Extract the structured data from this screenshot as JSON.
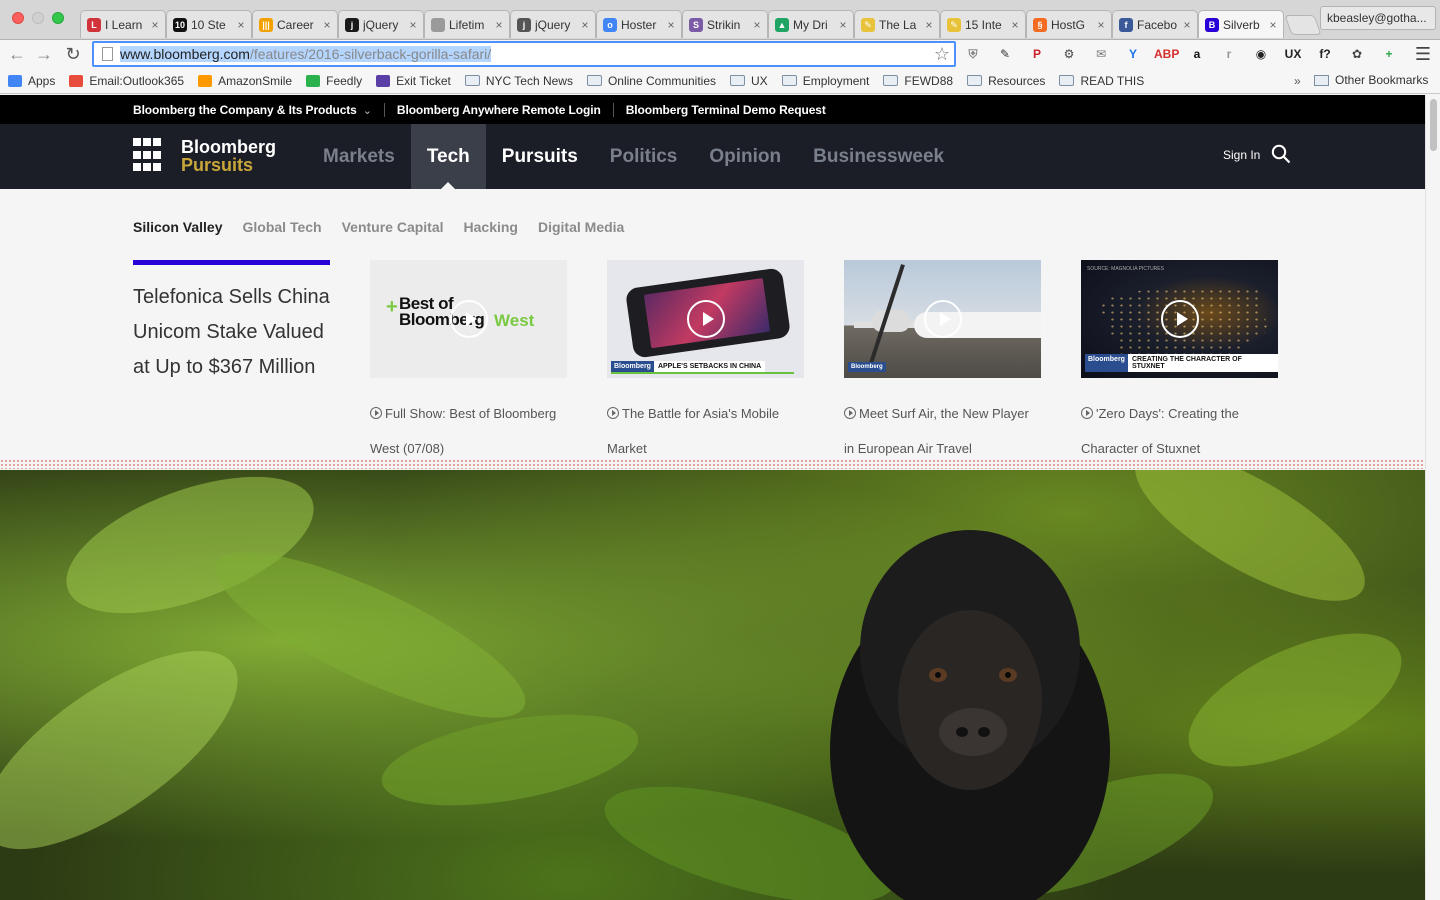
{
  "browser": {
    "tabs": [
      {
        "title": "I Learn",
        "fav_color": "#d0343a",
        "fav_glyph": "L"
      },
      {
        "title": "10 Ste",
        "fav_color": "#111111",
        "fav_glyph": "10"
      },
      {
        "title": "Career",
        "fav_color": "#f2a100",
        "fav_glyph": "|||"
      },
      {
        "title": "jQuery",
        "fav_color": "#1a1a1a",
        "fav_glyph": "j"
      },
      {
        "title": "Lifetim",
        "fav_color": "#9a9a9a",
        "fav_glyph": ""
      },
      {
        "title": "jQuery",
        "fav_color": "#555555",
        "fav_glyph": "j"
      },
      {
        "title": "Hoster",
        "fav_color": "#4285f4",
        "fav_glyph": "o"
      },
      {
        "title": "Strikin",
        "fav_color": "#7b5aa6",
        "fav_glyph": "S"
      },
      {
        "title": "My Dri",
        "fav_color": "#1fa463",
        "fav_glyph": "▲"
      },
      {
        "title": "The La",
        "fav_color": "#e8c33a",
        "fav_glyph": "✎"
      },
      {
        "title": "15 Inte",
        "fav_color": "#e8c33a",
        "fav_glyph": "✎"
      },
      {
        "title": "HostG",
        "fav_color": "#f36c21",
        "fav_glyph": "§"
      },
      {
        "title": "Facebo",
        "fav_color": "#3b5998",
        "fav_glyph": "f"
      },
      {
        "title": "Silverb",
        "fav_color": "#2800d7",
        "fav_glyph": "B"
      }
    ],
    "profile": "kbeasley@gotha...",
    "url_host": "www.bloomberg.com",
    "url_path": "/features/2016-silverback-gorilla-safari/",
    "bookmarks": [
      {
        "label": "Apps",
        "kind": "apps",
        "color": "#4285f4"
      },
      {
        "label": "Email:Outlook365",
        "kind": "site",
        "color": "#e74c3c"
      },
      {
        "label": "AmazonSmile",
        "kind": "site",
        "color": "#ff9900"
      },
      {
        "label": "Feedly",
        "kind": "site",
        "color": "#2bb24c"
      },
      {
        "label": "Exit Ticket",
        "kind": "site",
        "color": "#5a3fa6"
      },
      {
        "label": "NYC Tech News",
        "kind": "folder",
        "color": ""
      },
      {
        "label": "Online Communities",
        "kind": "folder",
        "color": ""
      },
      {
        "label": "UX",
        "kind": "folder",
        "color": ""
      },
      {
        "label": "Employment",
        "kind": "folder",
        "color": ""
      },
      {
        "label": "FEWD88",
        "kind": "folder",
        "color": ""
      },
      {
        "label": "Resources",
        "kind": "folder",
        "color": ""
      },
      {
        "label": "READ THIS",
        "kind": "folder",
        "color": ""
      }
    ],
    "bookmarks_overflow": "»",
    "other_bookmarks": "Other Bookmarks",
    "extensions": [
      {
        "name": "shield-icon",
        "glyph": "⛨",
        "color": "#888888"
      },
      {
        "name": "eyedropper-icon",
        "glyph": "✎",
        "color": "#333333"
      },
      {
        "name": "pinterest-icon",
        "glyph": "P",
        "color": "#cb2027"
      },
      {
        "name": "gear-icon",
        "glyph": "⚙",
        "color": "#444444"
      },
      {
        "name": "gmail-icon",
        "glyph": "✉",
        "color": "#777777"
      },
      {
        "name": "y-icon",
        "glyph": "Y",
        "color": "#1a73e8"
      },
      {
        "name": "adblock-icon",
        "glyph": "ABP",
        "color": "#d62d2d"
      },
      {
        "name": "amazon-icon",
        "glyph": "a",
        "color": "#111111"
      },
      {
        "name": "r-icon",
        "glyph": "r",
        "color": "#999999"
      },
      {
        "name": "panda-icon",
        "glyph": "◉",
        "color": "#222222"
      },
      {
        "name": "ux-check-icon",
        "glyph": "UX",
        "color": "#222222"
      },
      {
        "name": "font-icon",
        "glyph": "f?",
        "color": "#222222"
      },
      {
        "name": "evernote-icon",
        "glyph": "✿",
        "color": "#444444"
      },
      {
        "name": "news-icon",
        "glyph": "+",
        "color": "#2ba84a"
      }
    ]
  },
  "top_strip": {
    "company": "Bloomberg the Company & Its Products",
    "anywhere": "Bloomberg Anywhere Remote Login",
    "terminal": "Bloomberg Terminal Demo Request"
  },
  "brand": {
    "line1": "Bloomberg",
    "line2": "Pursuits"
  },
  "nav": [
    {
      "label": "Markets",
      "state": "dim"
    },
    {
      "label": "Tech",
      "state": "current"
    },
    {
      "label": "Pursuits",
      "state": "bright"
    },
    {
      "label": "Politics",
      "state": "dim"
    },
    {
      "label": "Opinion",
      "state": "dim"
    },
    {
      "label": "Businessweek",
      "state": "dim"
    }
  ],
  "sign_in": "Sign In",
  "subnav": [
    "Silicon Valley",
    "Global Tech",
    "Venture Capital",
    "Hacking",
    "Digital Media"
  ],
  "headline": "Telefonica Sells China Unicom Stake Valued at Up to $367 Million",
  "videos": [
    {
      "caption": "Full Show: Best of Bloomberg West (07/08)",
      "thumb_text_1": "Best of",
      "thumb_text_2": "Bloomberg",
      "thumb_text_3": "West"
    },
    {
      "caption": "The Battle for Asia's Mobile Market",
      "thumb_badge": "Bloomberg",
      "thumb_text": "APPLE'S SETBACKS IN CHINA"
    },
    {
      "caption": "Meet Surf Air, the New Player in European Air Travel",
      "thumb_badge": "Bloomberg"
    },
    {
      "caption": "'Zero Days': Creating the Character of Stuxnet",
      "thumb_badge": "Bloomberg",
      "thumb_text": "CREATING THE CHARACTER OF STUXNET",
      "thumb_source": "SOURCE: MAGNOLIA PICTURES"
    }
  ]
}
